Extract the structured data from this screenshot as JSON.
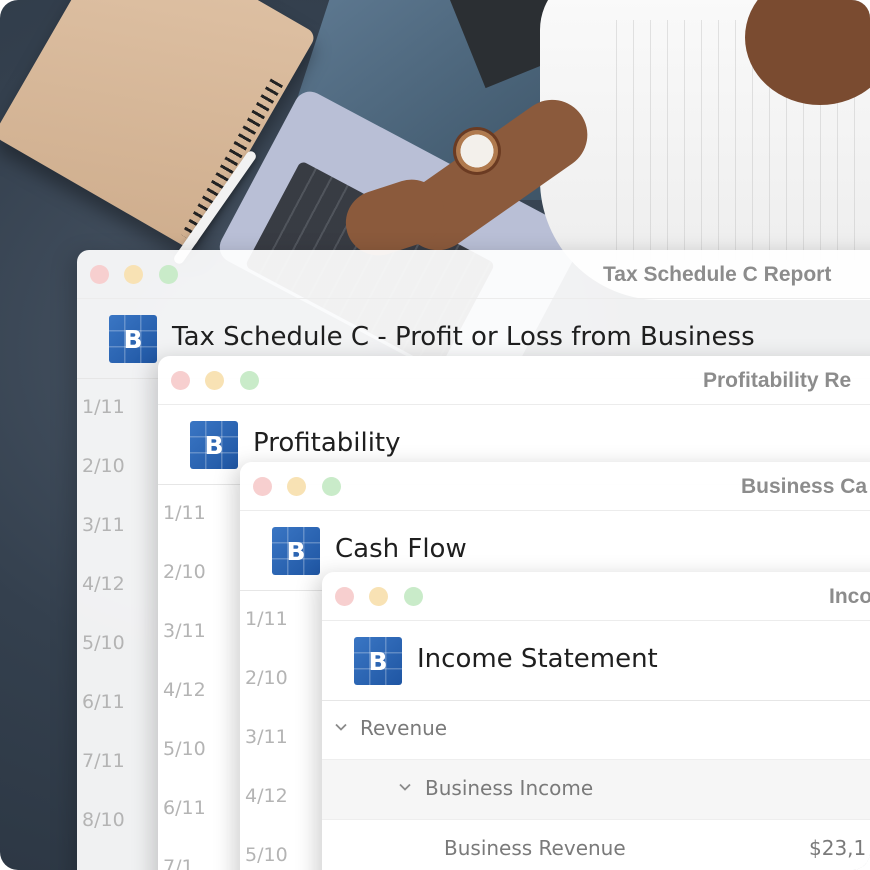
{
  "windows": [
    {
      "window_title": "Tax Schedule C Report",
      "header_title": "Tax Schedule C - Profit or Loss from Business",
      "dates": [
        "1/11",
        "2/10",
        "3/11",
        "4/12",
        "5/10",
        "6/11",
        "7/11",
        "8/10"
      ]
    },
    {
      "window_title": "Profitability Re",
      "header_title": "Profitability",
      "dates": [
        "1/11",
        "2/10",
        "3/11",
        "4/12",
        "5/10",
        "6/11",
        "7/1"
      ]
    },
    {
      "window_title": "Business Ca",
      "header_title": "Cash Flow",
      "dates": [
        "1/11",
        "2/10",
        "3/11",
        "4/12",
        "5/10"
      ]
    },
    {
      "window_title": "Inco",
      "header_title": "Income Statement",
      "rows": [
        {
          "label": "Revenue",
          "chevron": "chevron-down-icon"
        },
        {
          "label": "Business Income",
          "chevron": "chevron-down-icon"
        },
        {
          "label": "Business Revenue",
          "amount": "$23,1"
        }
      ]
    }
  ],
  "logo_letter": "B",
  "colors": {
    "logo_blue": "#2a65b5",
    "traffic_red": "#f7cfcf",
    "traffic_yellow": "#f8e2b4",
    "traffic_green": "#c9ebc9"
  }
}
